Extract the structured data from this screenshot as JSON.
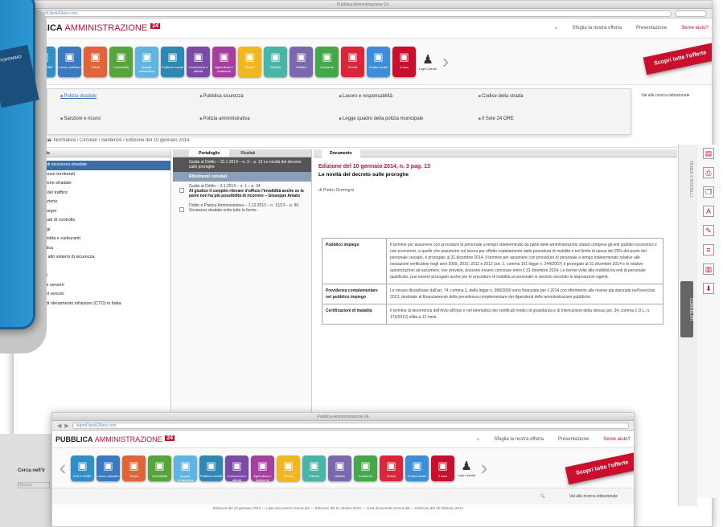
{
  "window_title": "Pubblica Amministrazione 24",
  "url": "lalpmf.ilsole24ore.com",
  "brand": {
    "name_a": "PUBBLICA",
    "name_b": "AMMINISTRAZIONE",
    "badge": "24"
  },
  "header_links": [
    {
      "label": "Sfoglia la nostra offerta"
    },
    {
      "label": "Presentazione"
    },
    {
      "label": "Serve aiuto?"
    }
  ],
  "categories": [
    {
      "label": "Enti e CMBP",
      "color": "#2f8fc6",
      "icon": "building-icon"
    },
    {
      "label": "Lavoro pubblico",
      "color": "#3a7ac0",
      "icon": "worker-icon"
    },
    {
      "label": "Tributi",
      "color": "#e0643a",
      "icon": "coins-icon"
    },
    {
      "label": "Contabilità",
      "color": "#57a43b",
      "icon": "calculator-icon"
    },
    {
      "label": "Appalti, Urbanistica",
      "color": "#5fb5e0",
      "icon": "crane-icon"
    },
    {
      "label": "Politiche sociali",
      "color": "#2e88b3",
      "icon": "people-icon"
    },
    {
      "label": "Commercio e attività",
      "color": "#7a4aa7",
      "icon": "cart-icon"
    },
    {
      "label": "Agricoltura e Ambiente",
      "color": "#a73fa0",
      "icon": "leaf-icon"
    },
    {
      "label": "Servizi",
      "color": "#efb820",
      "icon": "service-icon"
    },
    {
      "label": "Edilizia",
      "color": "#49b5a8",
      "icon": "house-icon"
    },
    {
      "label": "Utilities",
      "color": "#7b69b0",
      "icon": "plug-icon"
    },
    {
      "label": "Ambiente",
      "color": "#44a84a",
      "icon": "tree-icon"
    },
    {
      "label": "Eventi",
      "color": "#d9263a",
      "icon": "calendar-icon"
    },
    {
      "label": "Polizia locale",
      "color": "#3c8fd6",
      "icon": "badge-icon"
    },
    {
      "label": "Il caso",
      "color": "#c8102e",
      "icon": "case-icon"
    }
  ],
  "person_label": "Login Utente",
  "ribbon": "Scopri tutte l'offerte",
  "submenu": [
    {
      "label": "Polizia stradale",
      "active": true
    },
    {
      "label": "Pubblica sicurezza"
    },
    {
      "label": "Lavoro e responsabilità"
    },
    {
      "label": "Codice della strada"
    },
    {
      "label": "Sanzioni e ricorsi"
    },
    {
      "label": "Polizia amministrativa"
    },
    {
      "label": "Legge quadro della polizia municipale"
    },
    {
      "label": "Il Sole 24 ORE"
    }
  ],
  "right_panel": "Vai alla ricerca istituzionale",
  "breadcrumb": {
    "prefix": "Pagine ricerca:",
    "trail": "Normativa / Circolari / Sentenze / Edizione del 10 gennaio 2014"
  },
  "left_panel": {
    "title": "Polizia stradale",
    "tree": [
      {
        "label": "Patente di sicurezza stradale",
        "selected": true
      },
      {
        "label": "Competenze territoriali"
      },
      {
        "label": "Circolazione stradale"
      },
      {
        "label": "Barriere del traffico"
      },
      {
        "label": "Assicurazione"
      },
      {
        "label": "Contrassegni"
      },
      {
        "label": "Posti fissati di controllo"
      },
      {
        "label": "Parcheggi"
      },
      {
        "label": "Punti vendita e carburanti"
      },
      {
        "label": "Segnaletica"
      },
      {
        "label": "Veicoli e altri sistemi di sicurezza"
      },
      {
        "label": "Sinistri"
      },
      {
        "label": "Trasporti"
      },
      {
        "label": "Itinerari e sensori"
      },
      {
        "label": "Guida del veicolo"
      },
      {
        "label": "Sistemi di rilevamento infrazioni (CTO) in Italia"
      }
    ],
    "search_label": "Cerca nell'ir",
    "search_placeholder": "Ricerca"
  },
  "middle_panel": {
    "tabs": [
      "Portafoglio",
      "Risultati"
    ],
    "items": [
      {
        "text": "Guida al Diritto – 10.1.2014 – n. 3 – p. 13 Le novità del decreto sulle proroghe",
        "style": "dark"
      },
      {
        "text": "Riferimenti correlati",
        "style": "band"
      },
      {
        "text": "Guida al Diritto – 3.1.2014 – n. 1 – p. 34",
        "bold": "Al giudice il compito rilevare d'ufficio l'invalidità anche se la parte non ha più possibilità di ricorrere – Giuseppe Amato",
        "style": "check"
      },
      {
        "text": "Diritto e Pratica Amministrativa – 1.12.2013 – n. 12/13 – p. 80 Sicurezza stradale sotto tutte le forme",
        "style": "check"
      }
    ]
  },
  "document": {
    "tab": "Documento",
    "title": "Edizione del 10 gennaio 2014, n. 3 pag. 13",
    "subtitle": "Le novità del decreto sulle proroghe",
    "author": "di Pietro Gremigni",
    "table": [
      {
        "head": "Pubblico impiego",
        "body": "Il termine per assumere con procedure di personale a tempo indeterminato da parte delle amministrazioni statali compresi gli enti pubblici economici e non economici, a quelle che assumono sul lavoro per effetto espletamento dalla procedura di mobilità e nel limite di spesa del 20% del posto del personale cessato, è prorogato al 31 dicembre 2014. Il termine per assumere con procedure di personale a tempo indeterminato relative alle cessazioni verificatesi negli anni 2009, 2010, 2011 e 2012 (art. 1, comma 101 legge n. 244/2007) è prorogato al 31 dicembre 2014 e le relative autorizzazioni ad assumere, ove previste, possono essere concesse entro il 31 dicembre 2014. Le norme volte alla mobilità tra enti di personale qualificato, può essere prorogato anche per le procedure di mobilità al personale in servizio secondo le disposizioni vigenti."
      },
      {
        "head": "Previdenza complementare nel pubblico impiego",
        "body": "Le misure disciplinate dall'art. 74, comma 1, della legge n. 388/2000 sono finanziate per il 2014 con riferimento alle risorse già stanziate nell'esercizio 2013, destinate al finanziamento della previdenza complementare dei dipendenti delle amministrazioni pubbliche."
      },
      {
        "head": "Certificazioni di malattia",
        "body": "Il termine di decorrenza dell'invio all'Inps e nel telematico dei certificati medici di gravidanza e di interruzione della stessa (art. 34, comma 1 D.L. n. 179/2012) slitta a 12 mesi."
      }
    ]
  },
  "side_tabs": {
    "top": "TENDE E MODELLI",
    "bottom": "CORRELATI"
  },
  "side_left_tab": "TOPONIMO",
  "overlay_window": {
    "url": "lalpmf.ilsole24ore.com",
    "tail_breadcrumb": "Edizione del 10 gennaio 2014 — Lista documenti ricerca del — Edizione del 11 ottobre 2013 — Lista documenti ricerca dal — Edizione del 20 febbraio 2013"
  }
}
